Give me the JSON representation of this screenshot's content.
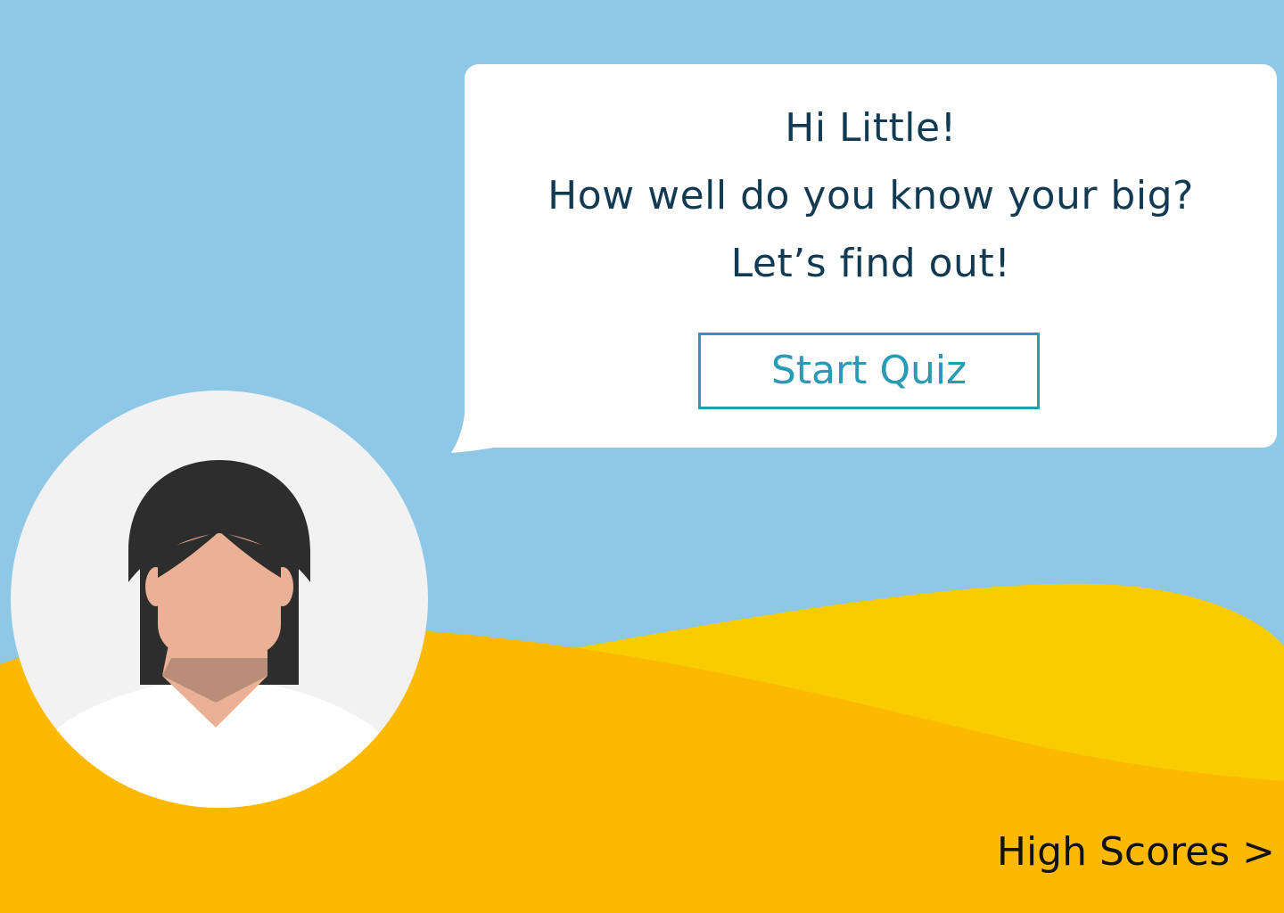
{
  "bubble": {
    "line1": "Hi Little!",
    "line2": "How well do you know your big?",
    "line3": "Let’s find out!"
  },
  "buttons": {
    "start_quiz": "Start Quiz"
  },
  "footer": {
    "high_scores": "High Scores >"
  },
  "avatar": {
    "icon": "person-avatar-icon"
  },
  "colors": {
    "sky": "#8fc7e6",
    "hill_back": "#f9cc00",
    "hill_front": "#fdb900",
    "text_dark": "#123a52",
    "accent_teal": "#2a9bb5",
    "bubble": "#ffffff",
    "avatar_bg": "#f2f2f2",
    "hair": "#2d2d2d",
    "skin": "#ebb196",
    "shirt": "#ffffff"
  }
}
